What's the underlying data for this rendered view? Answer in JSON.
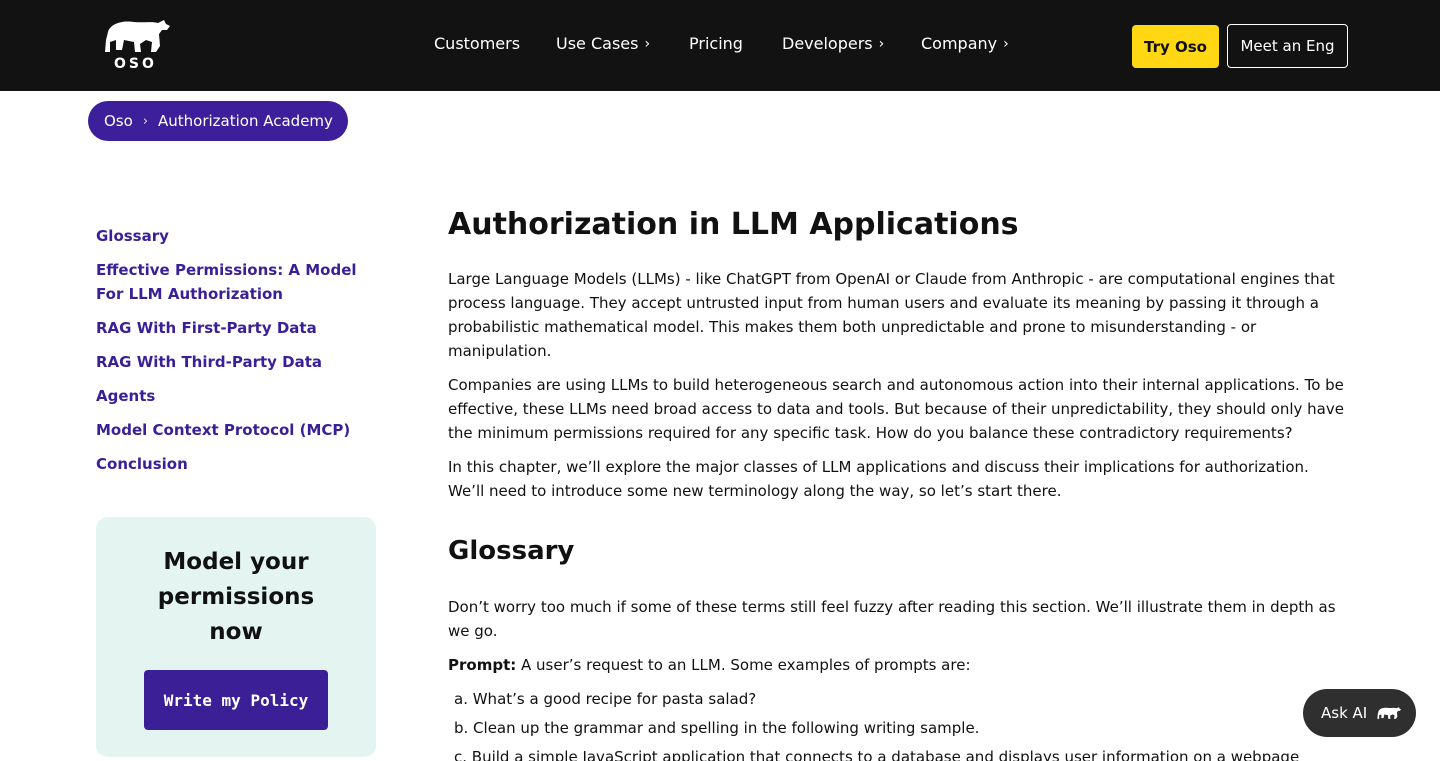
{
  "header": {
    "logo_text": "OSO",
    "nav": [
      {
        "label": "Customers",
        "has_chevron": false
      },
      {
        "label": "Use Cases",
        "has_chevron": true
      },
      {
        "label": "Pricing",
        "has_chevron": false
      },
      {
        "label": "Developers",
        "has_chevron": true
      },
      {
        "label": "Company",
        "has_chevron": true
      }
    ],
    "try_label": "Try Oso",
    "meet_label": "Meet an Eng",
    "colors": {
      "bar": "#121212",
      "try_bg": "#ffd713"
    }
  },
  "breadcrumb": {
    "items": [
      "Oso",
      "Authorization Academy"
    ],
    "separator": "›",
    "color": "#3d1f9c"
  },
  "toc": {
    "items": [
      "Glossary",
      "Effective Permissions: A Model For LLM Authorization",
      "RAG With First-Party Data",
      "RAG With Third-Party Data",
      "Agents",
      "Model Context Protocol (MCP)",
      "Conclusion"
    ]
  },
  "cta": {
    "title_line1": "Model your",
    "title_line2": "permissions",
    "title_line3": "now",
    "button_label": "Write my Policy"
  },
  "article": {
    "title": "Authorization in LLM Applications",
    "p1": "Large Language Models (LLMs) - like ChatGPT from OpenAI or Claude from Anthropic - are computational engines that process language. They accept untrusted input from human users and evaluate its meaning by passing it through a probabilistic mathematical model. This makes them both unpredictable and prone to misunderstanding - or manipulation.",
    "p2": "Companies are using LLMs to build heterogeneous search and autonomous action into their internal applications. To be effective, these LLMs need broad access to data and tools. But because of their unpredictability, they should only have the minimum permissions required for any specific task. How do you balance these contradictory requirements?",
    "p3": "In this chapter, we’ll explore the major classes of LLM applications and discuss their implications for authorization. We’ll need to introduce some new terminology along the way, so let’s start there.",
    "h2_glossary": "Glossary",
    "p4": "Don’t worry too much if some of these terms still feel fuzzy after reading this section. We’ll illustrate them in depth as we go.",
    "prompt_term": "Prompt:",
    "prompt_def": " A user’s request to an LLM. Some examples of prompts are:",
    "examples": [
      "a. What’s a good recipe for pasta salad?",
      "b. Clean up the grammar and spelling in the following writing sample.",
      "c. Build a simple JavaScript application that connects to a database and displays user information on a webpage"
    ]
  },
  "ask_ai": {
    "label": "Ask AI"
  }
}
